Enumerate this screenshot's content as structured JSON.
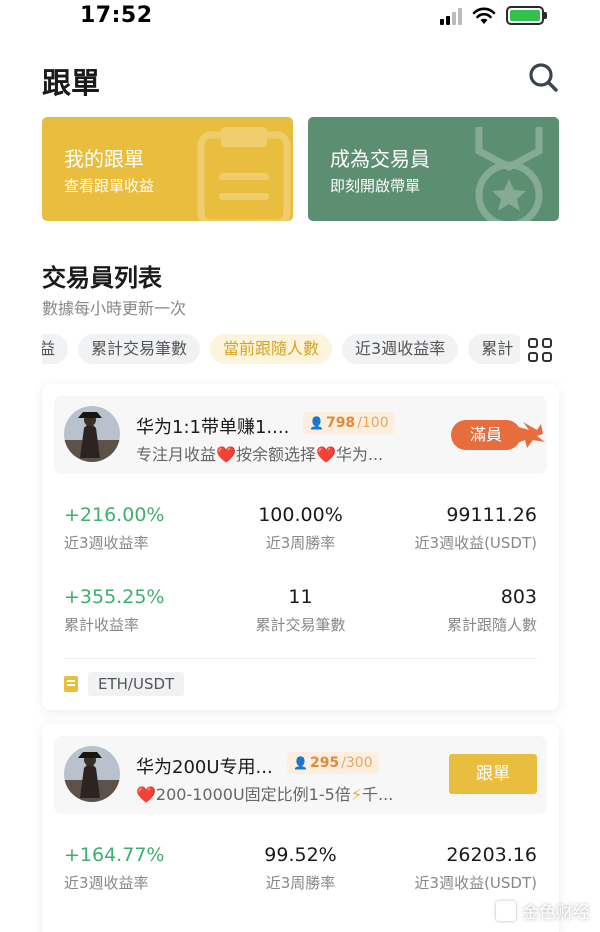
{
  "status_bar": {
    "time": "17:52"
  },
  "header": {
    "title": "跟單"
  },
  "top_cards": [
    {
      "title": "我的跟單",
      "subtitle": "查看跟單收益",
      "color": "#e9bd3d"
    },
    {
      "title": "成為交易員",
      "subtitle": "即刻開啟帶單",
      "color": "#5c8e72"
    }
  ],
  "section": {
    "title": "交易員列表",
    "subtitle": "數據每小時更新一次"
  },
  "sort_tabs": [
    {
      "label": "益"
    },
    {
      "label": "累計交易筆數"
    },
    {
      "label": "當前跟隨人數",
      "active": true
    },
    {
      "label": "近3週收益率"
    },
    {
      "label": "累計"
    }
  ],
  "traders": [
    {
      "name": "华为1:1带单赚1....",
      "followers_current": "798",
      "followers_max": "/100",
      "desc_parts": [
        "专注月收益",
        "❤️",
        "按余额选择",
        "❤️",
        "华为..."
      ],
      "status": "滿員",
      "stats": {
        "roi_3w": "+216.00%",
        "roi_3w_label": "近3週收益率",
        "win_rate_3w": "100.00%",
        "win_rate_3w_label": "近3周勝率",
        "pnl_3w": "99111.26",
        "pnl_3w_label": "近3週收益(USDT)",
        "total_roi": "+355.25%",
        "total_roi_label": "累計收益率",
        "total_trades": "11",
        "total_trades_label": "累計交易筆數",
        "total_followers": "803",
        "total_followers_label": "累計跟隨人數"
      },
      "pair": "ETH/USDT"
    },
    {
      "name": "华为200U专用...",
      "followers_current": "295",
      "followers_max": "/300",
      "desc_parts": [
        "❤️",
        "200-1000U固定比例1-5倍",
        "⚡",
        "千..."
      ],
      "action": "跟單",
      "stats": {
        "roi_3w": "+164.77%",
        "roi_3w_label": "近3週收益率",
        "win_rate_3w": "99.52%",
        "win_rate_3w_label": "近3周勝率",
        "pnl_3w": "26203.16",
        "pnl_3w_label": "近3週收益(USDT)"
      }
    }
  ],
  "watermark": {
    "text": "金色财经"
  },
  "colors": {
    "accent_gold": "#e9bd3d",
    "accent_green": "#5c8e72",
    "profit_green": "#3fae6e",
    "full_orange": "#e86d3d"
  }
}
